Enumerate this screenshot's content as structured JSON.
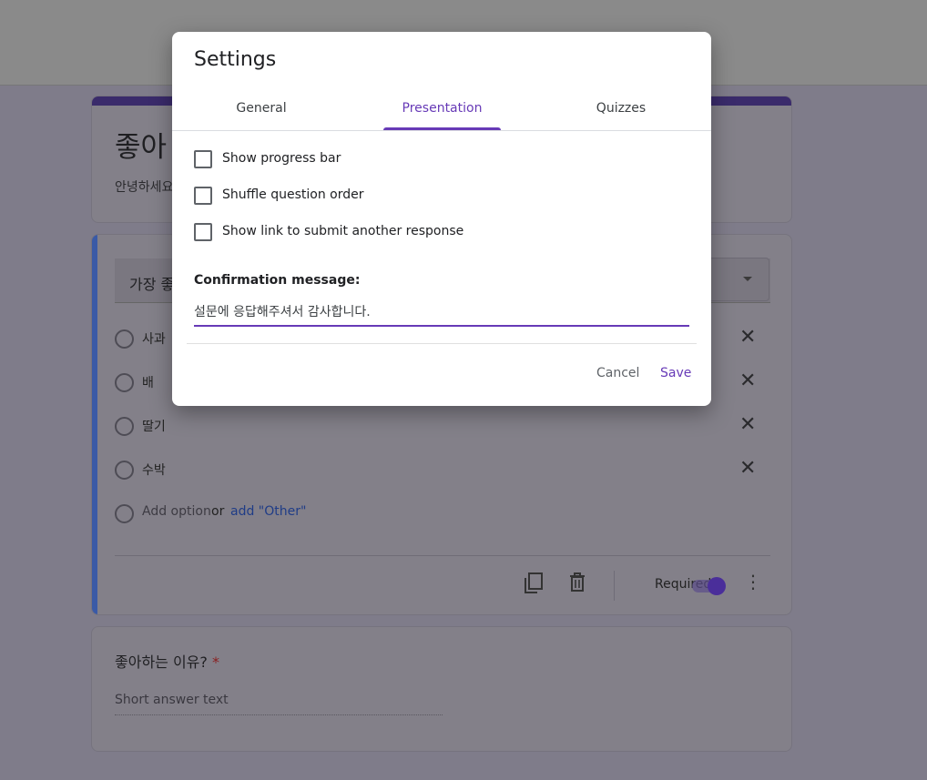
{
  "form": {
    "title": "좋아",
    "description": "안녕하세요",
    "question": {
      "title_partial": "가장 좋",
      "options": [
        "사과",
        "배",
        "딸기",
        "수박"
      ],
      "add_option": "Add option",
      "or": "or",
      "add_other": "add \"Other\"",
      "required_label": "Required",
      "required": true
    },
    "question2": {
      "title": "좋아하는 이유?",
      "required_mark": "*",
      "placeholder": "Short answer text"
    }
  },
  "dialog": {
    "title": "Settings",
    "tabs": [
      "General",
      "Presentation",
      "Quizzes"
    ],
    "active_tab": "Presentation",
    "checkboxes": [
      {
        "label": "Show progress bar",
        "checked": false
      },
      {
        "label": "Shuffle question order",
        "checked": false
      },
      {
        "label": "Show link to submit another response",
        "checked": false
      }
    ],
    "confirmation_label": "Confirmation message:",
    "confirmation_value": "설문에 응답해주셔서 감사합니다.",
    "cancel_label": "Cancel",
    "save_label": "Save"
  },
  "colors": {
    "accent": "#673ab7",
    "question_bar": "#3a5aa6"
  }
}
